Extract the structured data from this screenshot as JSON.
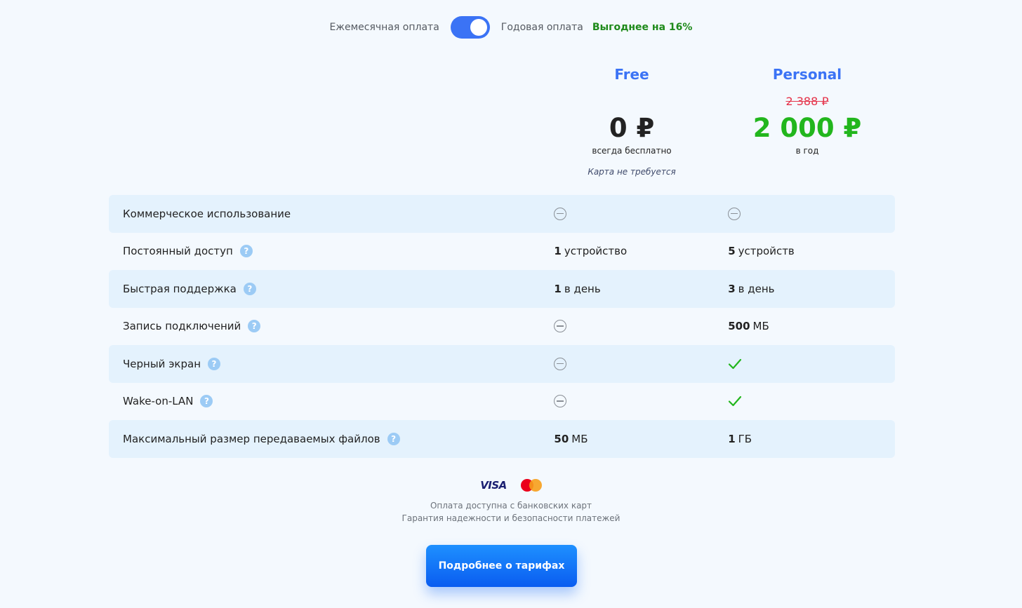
{
  "billing": {
    "monthly_label": "Ежемесячная оплата",
    "annual_label": "Годовая оплата",
    "savings_prefix": "Выгоднее на",
    "savings_value": "16%",
    "annual_selected": true
  },
  "plans": [
    {
      "name": "Free",
      "old_price": "",
      "price": "0 ₽",
      "period": "всегда бесплатно",
      "note": "Карта не требуется"
    },
    {
      "name": "Personal",
      "old_price": "2 388 ₽",
      "price": "2 000 ₽",
      "period": "в год",
      "note": ""
    }
  ],
  "features": [
    {
      "name": "Коммерческое использование",
      "help": false,
      "free": {
        "type": "none"
      },
      "personal": {
        "type": "none"
      }
    },
    {
      "name": "Постоянный доступ",
      "help": true,
      "free": {
        "type": "text",
        "bold": "1",
        "rest": "устройство"
      },
      "personal": {
        "type": "text",
        "bold": "5",
        "rest": "устройств"
      }
    },
    {
      "name": "Быстрая поддержка",
      "help": true,
      "free": {
        "type": "text",
        "bold": "1",
        "rest": "в день"
      },
      "personal": {
        "type": "text",
        "bold": "3",
        "rest": "в день"
      }
    },
    {
      "name": "Запись подключений",
      "help": true,
      "free": {
        "type": "none"
      },
      "personal": {
        "type": "text",
        "bold": "500",
        "rest": "МБ"
      }
    },
    {
      "name": "Черный экран",
      "help": true,
      "free": {
        "type": "none"
      },
      "personal": {
        "type": "check"
      }
    },
    {
      "name": "Wake-on-LAN",
      "help": true,
      "free": {
        "type": "none"
      },
      "personal": {
        "type": "check"
      }
    },
    {
      "name": "Максимальный размер передаваемых файлов",
      "help": true,
      "free": {
        "type": "text",
        "bold": "50",
        "rest": "МБ"
      },
      "personal": {
        "type": "text",
        "bold": "1",
        "rest": "ГБ"
      }
    }
  ],
  "help_glyph": "?",
  "payment": {
    "visa_label": "VISA",
    "line1": "Оплата доступна с банковских карт",
    "line2": "Гарантия надежности и безопасности платежей"
  },
  "cta_label": "Подробнее о тарифах",
  "colors": {
    "accent": "#3b73f5",
    "price_green": "#22b61d",
    "strike_red": "#e5334a",
    "row_stripe": "#e4f2fd",
    "savings_green": "#1e8a1a"
  }
}
